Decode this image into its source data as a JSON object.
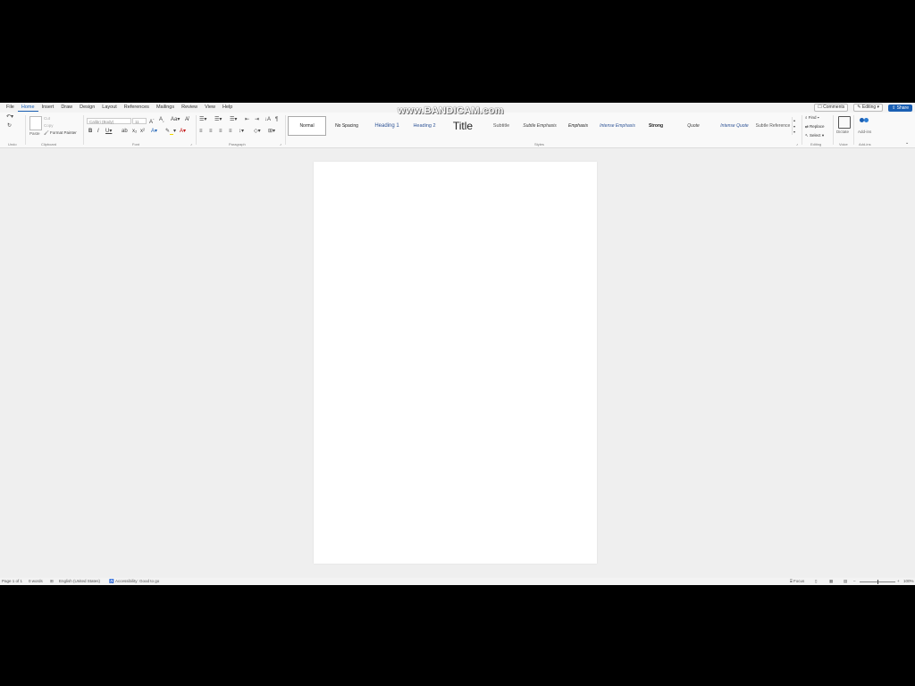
{
  "watermark": "www.BANDICAM.com",
  "tabs": [
    "File",
    "Home",
    "Insert",
    "Draw",
    "Design",
    "Layout",
    "References",
    "Mailings",
    "Review",
    "View",
    "Help"
  ],
  "active_tab": "Home",
  "top_right": {
    "comments": "Comments",
    "editing": "Editing",
    "share": "Share"
  },
  "undo": {
    "label": "Undo"
  },
  "clipboard": {
    "paste": "Paste",
    "cut": "Cut",
    "copy": "Copy",
    "format_painter": "Format Painter",
    "group": "Clipboard"
  },
  "font": {
    "name": "Calibri (Body)",
    "size": "11",
    "group": "Font"
  },
  "paragraph": {
    "group": "Paragraph"
  },
  "styles": {
    "items": [
      "Normal",
      "No Spacing",
      "Heading 1",
      "Heading 2",
      "Title",
      "Subtitle",
      "Subtle Emphasis",
      "Emphasis",
      "Intense Emphasis",
      "Strong",
      "Quote",
      "Intense Quote",
      "Subtle Reference"
    ],
    "selected": "Normal",
    "group": "Styles"
  },
  "editing": {
    "find": "Find",
    "replace": "Replace",
    "select": "Select",
    "group": "Editing"
  },
  "voice": {
    "dictate": "Dictate",
    "group": "Voice"
  },
  "addins": {
    "label": "Add-ins",
    "group": "Add-ins"
  },
  "status": {
    "page": "Page 1 of 1",
    "words": "0 words",
    "language": "English (United States)",
    "accessibility": "Accessibility: Good to go",
    "zoom": "100%"
  },
  "colors": {
    "accent": "#1a5fb4",
    "highlight": "#f5d800",
    "font_color": "#c00000"
  }
}
